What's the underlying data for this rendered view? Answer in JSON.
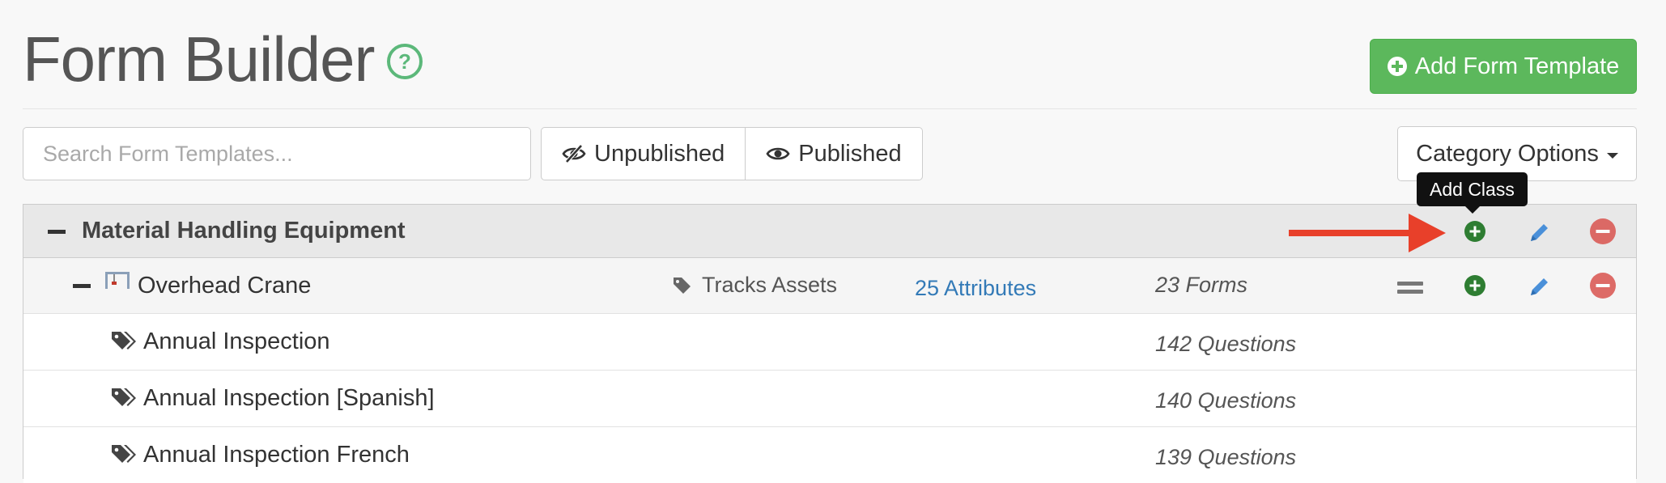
{
  "header": {
    "title": "Form Builder",
    "help_icon": "?",
    "add_template_label": "Add Form Template"
  },
  "toolbar": {
    "search_placeholder": "Search Form Templates...",
    "filter_unpublished": "Unpublished",
    "filter_published": "Published",
    "category_options_label": "Category Options"
  },
  "tooltip": {
    "text": "Add Class"
  },
  "category": {
    "name": "Material Handling Equipment"
  },
  "class_row": {
    "name": "Overhead Crane",
    "tracks_label": "Tracks Assets",
    "attributes_link": "25 Attributes",
    "forms_count": "23 Forms"
  },
  "forms": [
    {
      "name": "Annual Inspection",
      "questions": "142 Questions"
    },
    {
      "name": "Annual Inspection [Spanish]",
      "questions": "140 Questions"
    },
    {
      "name": "Annual Inspection French",
      "questions": "139 Questions"
    }
  ],
  "colors": {
    "primary_green": "#5cb85c",
    "add_icon_green": "#2e7d32",
    "edit_blue": "#337ab7",
    "remove_red": "#d9534f",
    "annotation_arrow": "#e8402a"
  }
}
